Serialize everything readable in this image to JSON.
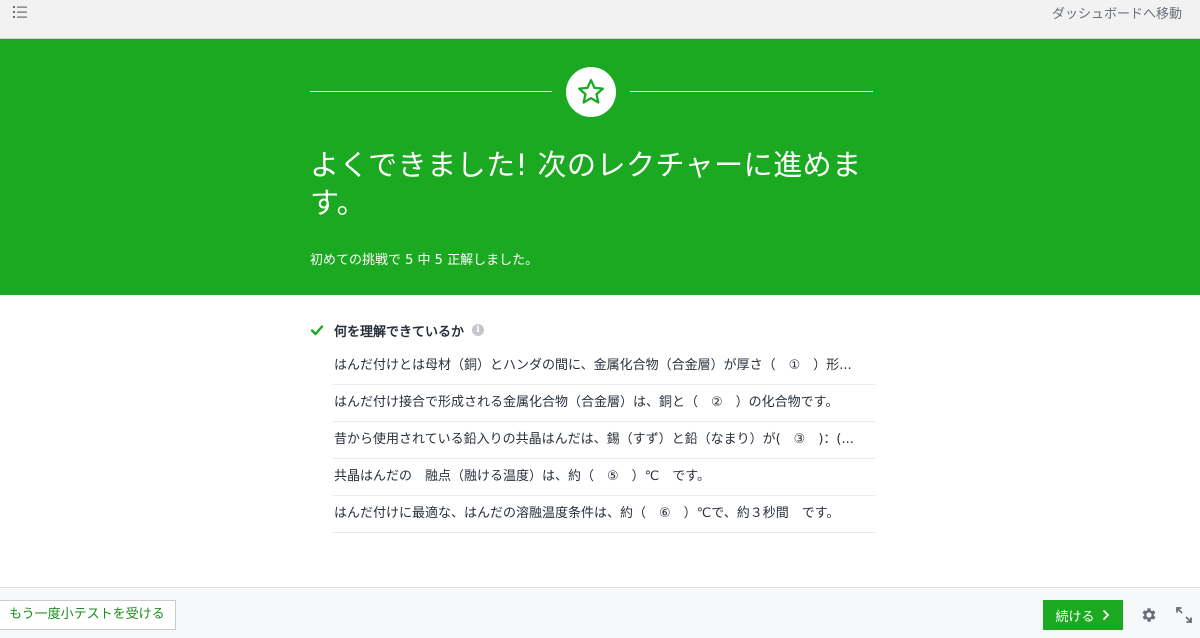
{
  "topbar": {
    "dashboard_link": "ダッシュボードへ移動",
    "menu_icon": "list-icon"
  },
  "banner": {
    "icon": "star-icon",
    "title": "よくできました! 次のレクチャーに進めます。",
    "subtitle": "初めての挑戦で 5 中 5 正解しました。"
  },
  "results": {
    "heading": "何を理解できているか",
    "heading_icon": "check-icon",
    "info_icon": "info-icon",
    "questions": [
      "はんだ付けとは母材（銅）とハンダの間に、金属化合物（合金層）が厚さ（　①　）形...",
      "はんだ付け接合で形成される金属化合物（合金層）は、銅と（　②　）の化合物です。",
      "昔から使用されている鉛入りの共晶はんだは、錫（すず）と鉛（なまり）が(　③　)：(...",
      "共晶はんだの　融点（融ける温度）は、約（　⑤　）℃　です。",
      "はんだ付けに最適な、はんだの溶融温度条件は、約（　⑥　）℃で、約３秒間　です。"
    ]
  },
  "footer": {
    "retake_label": "もう一度小テストを受ける",
    "continue_label": "続ける",
    "settings_icon": "gear-icon",
    "fullscreen_icon": "expand-icon"
  },
  "colors": {
    "accent": "#1aa920",
    "text": "#29303b"
  }
}
